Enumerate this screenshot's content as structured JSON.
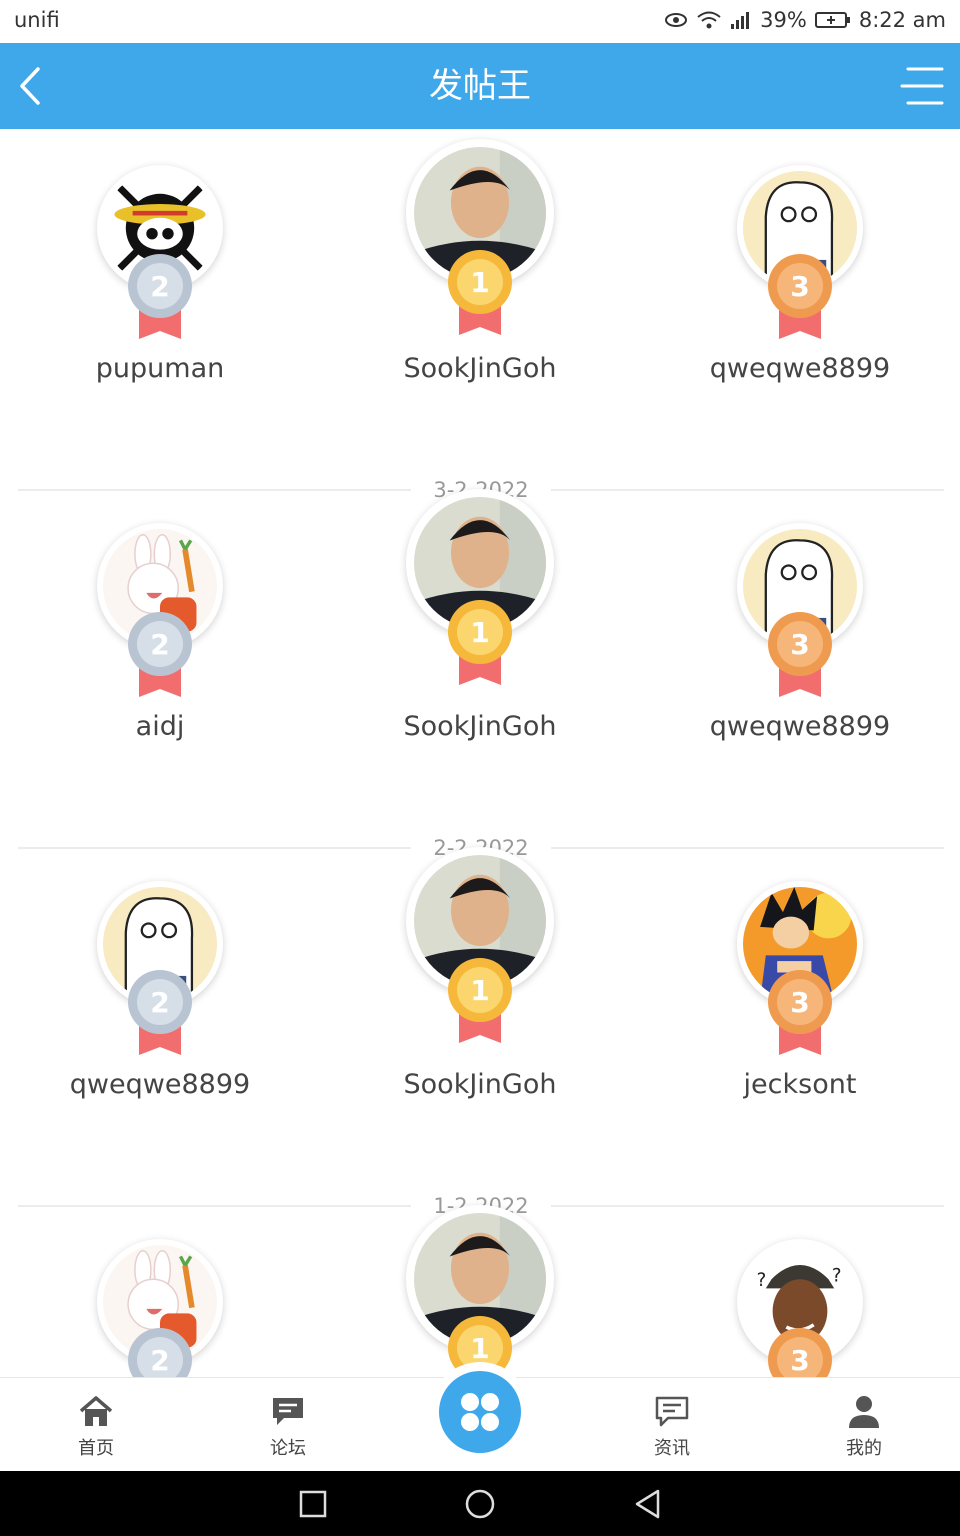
{
  "status_bar": {
    "carrier": "unifi",
    "battery": "39%",
    "time": "8:22 am"
  },
  "header": {
    "title": "发帖王"
  },
  "blocks": [
    {
      "date": "",
      "users": [
        {
          "name": "pupuman",
          "rank": "2",
          "avatar": "one-piece-skull-avatar"
        },
        {
          "name": "SookJinGoh",
          "rank": "1",
          "avatar": "man-portrait-avatar"
        },
        {
          "name": "qweqwe8899",
          "rank": "3",
          "avatar": "white-ghost-cartoon-avatar"
        }
      ]
    },
    {
      "date": "3-2-2022",
      "users": [
        {
          "name": "aidj",
          "rank": "2",
          "avatar": "bunny-cartoon-avatar"
        },
        {
          "name": "SookJinGoh",
          "rank": "1",
          "avatar": "man-portrait-avatar"
        },
        {
          "name": "qweqwe8899",
          "rank": "3",
          "avatar": "white-ghost-cartoon-avatar"
        }
      ]
    },
    {
      "date": "2-2-2022",
      "users": [
        {
          "name": "qweqwe8899",
          "rank": "2",
          "avatar": "white-ghost-cartoon-avatar"
        },
        {
          "name": "SookJinGoh",
          "rank": "1",
          "avatar": "man-portrait-avatar"
        },
        {
          "name": "jecksont",
          "rank": "3",
          "avatar": "goku-cartoon-avatar"
        }
      ]
    },
    {
      "date": "1-2-2022",
      "users": [
        {
          "name": "",
          "rank": "2",
          "avatar": "bunny-cartoon-avatar"
        },
        {
          "name": "",
          "rank": "1",
          "avatar": "man-portrait-avatar"
        },
        {
          "name": "",
          "rank": "3",
          "avatar": "confused-man-avatar"
        }
      ]
    }
  ],
  "bottom_nav": [
    {
      "label": "首页",
      "icon": "home-icon"
    },
    {
      "label": "论坛",
      "icon": "forum-icon"
    },
    {
      "label": "",
      "icon": "apps-icon"
    },
    {
      "label": "资讯",
      "icon": "news-icon"
    },
    {
      "label": "我的",
      "icon": "profile-icon"
    }
  ],
  "colors": {
    "accent": "#3ea8ea",
    "gold": "#f5b83a",
    "silver": "#b9c4d2",
    "bronze": "#ef9b4f",
    "ribbon": "#f26e6e"
  }
}
